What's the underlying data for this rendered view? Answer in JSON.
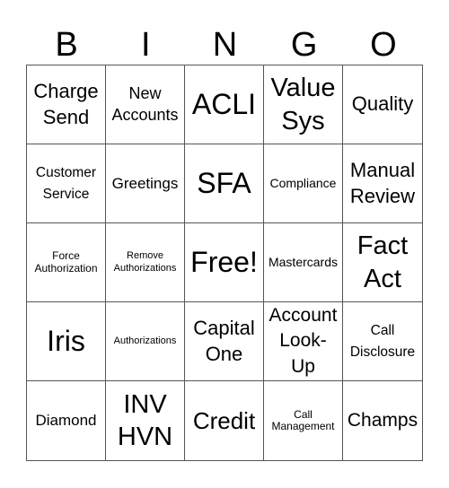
{
  "header": {
    "letters": [
      "B",
      "I",
      "N",
      "G",
      "O"
    ]
  },
  "cells": [
    {
      "text": "Charge\nSend",
      "size": "s22"
    },
    {
      "text": "New\nAccounts",
      "size": "s18"
    },
    {
      "text": "ACLI",
      "size": "s32"
    },
    {
      "text": "Value\nSys",
      "size": "s29"
    },
    {
      "text": "Quality",
      "size": "s22"
    },
    {
      "text": "Customer\nService",
      "size": "s15"
    },
    {
      "text": "Greetings",
      "size": "s17"
    },
    {
      "text": "SFA",
      "size": "s32"
    },
    {
      "text": "Compliance",
      "size": "s14"
    },
    {
      "text": "Manual\nReview",
      "size": "s22"
    },
    {
      "text": "Force\nAuthorization",
      "size": "s12"
    },
    {
      "text": "Remove\nAuthorizations",
      "size": "s11"
    },
    {
      "text": "Free!",
      "size": "s32"
    },
    {
      "text": "Mastercards",
      "size": "s14"
    },
    {
      "text": "Fact\nAct",
      "size": "s29"
    },
    {
      "text": "Iris",
      "size": "s32"
    },
    {
      "text": "Authorizations",
      "size": "s11"
    },
    {
      "text": "Capital\nOne",
      "size": "s22"
    },
    {
      "text": "Account\nLook-\nUp",
      "size": "s20"
    },
    {
      "text": "Call\nDisclosure",
      "size": "s15"
    },
    {
      "text": "Diamond",
      "size": "s17"
    },
    {
      "text": "INV\nHVN",
      "size": "s29"
    },
    {
      "text": "Credit",
      "size": "s26"
    },
    {
      "text": "Call\nManagement",
      "size": "s12"
    },
    {
      "text": "Champs",
      "size": "s20"
    }
  ]
}
